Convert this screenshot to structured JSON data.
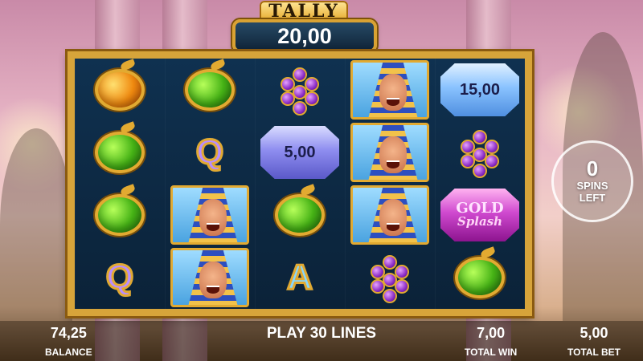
{
  "tally": {
    "label": "TALLY",
    "value": "20,00"
  },
  "reels": [
    [
      {
        "type": "orange"
      },
      {
        "type": "apple"
      },
      {
        "type": "apple"
      },
      {
        "type": "letter",
        "value": "Q"
      }
    ],
    [
      {
        "type": "apple"
      },
      {
        "type": "letter",
        "value": "Q"
      },
      {
        "type": "pharaoh"
      },
      {
        "type": "pharaoh"
      }
    ],
    [
      {
        "type": "grapes"
      },
      {
        "type": "gem",
        "value": "5,00",
        "color": "purple"
      },
      {
        "type": "apple"
      },
      {
        "type": "letter",
        "value": "A"
      }
    ],
    [
      {
        "type": "pharaoh"
      },
      {
        "type": "pharaoh"
      },
      {
        "type": "pharaoh"
      },
      {
        "type": "grapes"
      }
    ],
    [
      {
        "type": "gem",
        "value": "15,00",
        "color": "blue"
      },
      {
        "type": "grapes"
      },
      {
        "type": "gold_splash",
        "line1": "GOLD",
        "line2": "Splash"
      },
      {
        "type": "apple"
      }
    ]
  ],
  "spins": {
    "count": "0",
    "label_line1": "SPINS",
    "label_line2": "LEFT"
  },
  "bottom": {
    "balance_value": "74,25",
    "balance_label": "BALANCE",
    "play_lines": "PLAY 30 LINES",
    "total_win_value": "7,00",
    "total_win_label": "TOTAL WIN",
    "total_bet_value": "5,00",
    "total_bet_label": "TOTAL BET"
  },
  "colors": {
    "frame_gold": "#d7a43a",
    "reel_bg": "#0f3150",
    "tally_bg": "#0f2438"
  }
}
